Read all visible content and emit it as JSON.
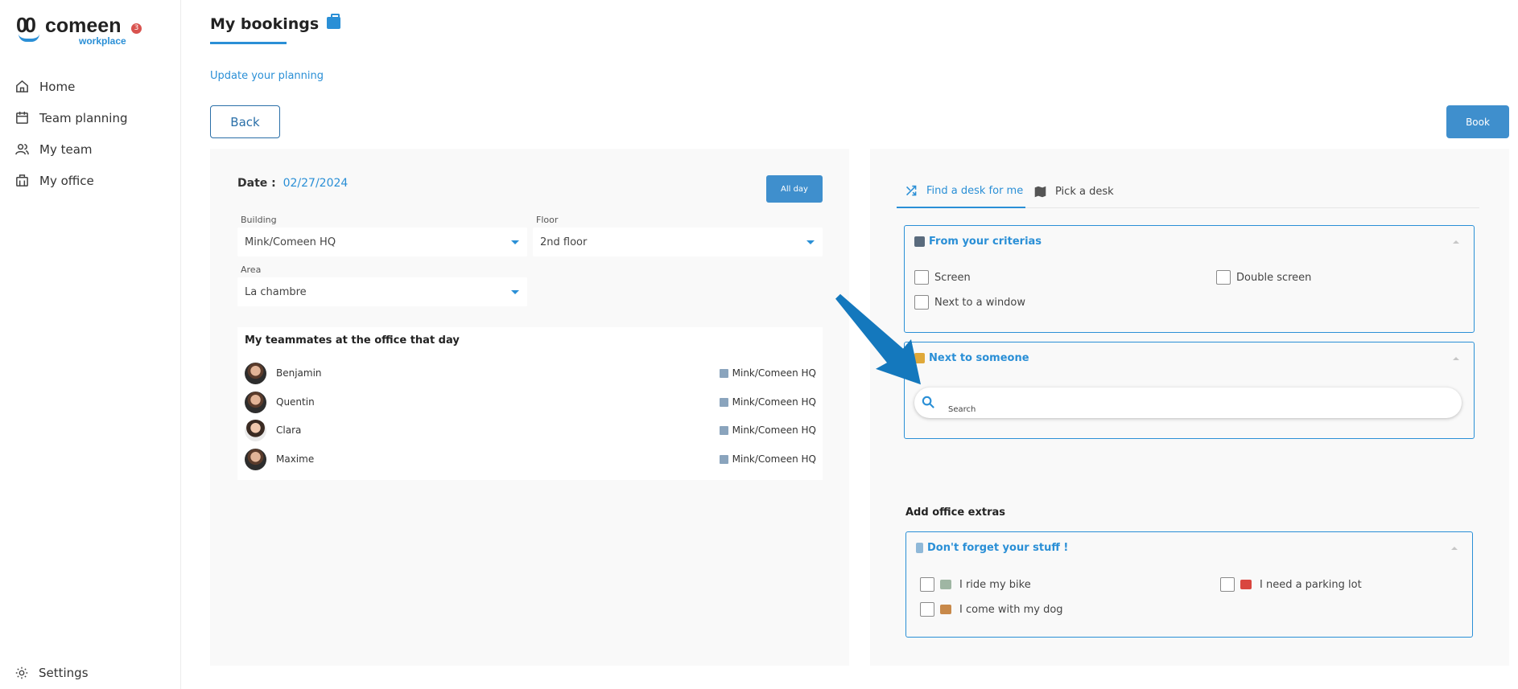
{
  "sidebar": {
    "logo_mark": "00",
    "logo_word": "comeen",
    "logo_sub": "workplace",
    "notification_count": "3",
    "items": [
      {
        "label": "Home",
        "icon": "home-icon"
      },
      {
        "label": "Team planning",
        "icon": "calendar-icon"
      },
      {
        "label": "My team",
        "icon": "users-icon"
      },
      {
        "label": "My office",
        "icon": "building-icon"
      }
    ],
    "settings_label": "Settings"
  },
  "header": {
    "title": "My bookings",
    "update_link": "Update your planning",
    "back_label": "Back",
    "book_label": "Book"
  },
  "left": {
    "date_label": "Date :",
    "date_value": "02/27/2024",
    "allday_label": "All day",
    "building_label": "Building",
    "building_value": "Mink/Comeen HQ",
    "floor_label": "Floor",
    "floor_value": "2nd floor",
    "area_label": "Area",
    "area_value": "La chambre",
    "teammates_title": "My teammates at the office that day",
    "teammates": [
      {
        "name": "Benjamin",
        "building": "Mink/Comeen HQ"
      },
      {
        "name": "Quentin",
        "building": "Mink/Comeen HQ"
      },
      {
        "name": "Clara",
        "building": "Mink/Comeen HQ"
      },
      {
        "name": "Maxime",
        "building": "Mink/Comeen HQ"
      }
    ]
  },
  "right": {
    "tabs": [
      {
        "label": "Find a desk for me",
        "active": true
      },
      {
        "label": "Pick a desk",
        "active": false
      }
    ],
    "criteria_title": "From your criterias",
    "criteria": [
      "Screen",
      "Double screen",
      "Next to a window"
    ],
    "someone_title": "Next to someone",
    "search_placeholder": "Search",
    "extras_title": "Add office extras",
    "stuff_title": "Don't forget your stuff !",
    "extras": [
      "I ride my bike",
      "I need a parking lot",
      "I come with my dog"
    ]
  },
  "colors": {
    "accent": "#2a8fd6",
    "button": "#3f8fcd",
    "arrow": "#1478bd"
  }
}
